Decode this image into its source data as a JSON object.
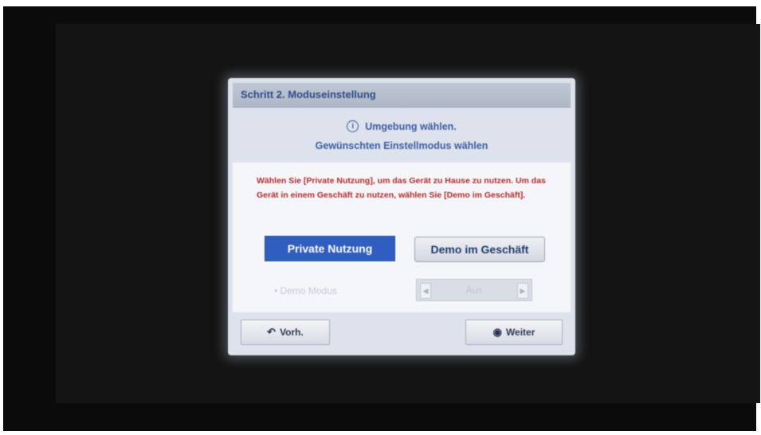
{
  "dialog": {
    "title": "Schritt 2. Moduseinstellung",
    "info_icon": "info-icon",
    "subtitle_line1": "Umgebung wählen.",
    "subtitle_line2": "Gewünschten Einstellmodus wählen",
    "notice": "Wählen Sie [Private Nutzung], um das Gerät zu Hause zu nutzen. Um das Gerät in einem Geschäft zu nutzen, wählen Sie [Demo im Geschäft].",
    "buttons": {
      "private_label": "Private Nutzung",
      "demo_label": "Demo im Geschäft"
    },
    "demo_mode": {
      "label": "• Demo Modus",
      "value": "Aus",
      "left_arrow": "◀",
      "right_arrow": "▶"
    },
    "footer": {
      "back_label": "Vorh.",
      "back_icon": "back-icon",
      "back_glyph": "↶",
      "next_label": "Weiter",
      "next_icon": "ok-icon",
      "next_glyph": "◉"
    }
  },
  "colors": {
    "accent": "#2f5dc0",
    "notice": "#b42a2a",
    "subtitle": "#3b5da4",
    "dialog_bg": "#dde2ec"
  }
}
